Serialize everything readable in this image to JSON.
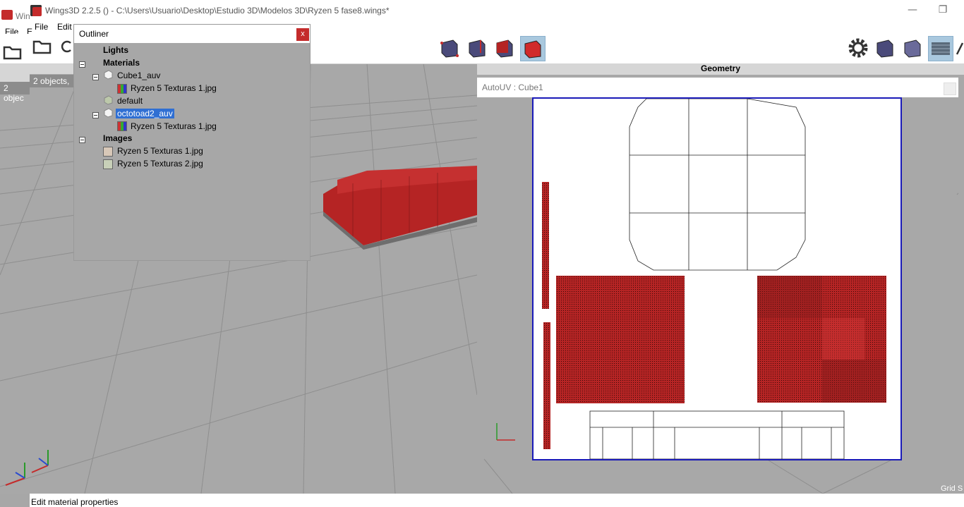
{
  "window": {
    "title": "Wings3D 2.2.5 () - C:\\Users\\Usuario\\Desktop\\Estudio 3D\\Modelos 3D\\Ryzen 5 fase8.wings*",
    "behind_title": "Win",
    "min_glyph": "—",
    "restore_glyph": "❐"
  },
  "menu": {
    "file_back": "File",
    "edit_back": "E",
    "file": "File",
    "edit": "Edit"
  },
  "geometry_info": {
    "back": "2 objec",
    "front": "2 objects, "
  },
  "outliner": {
    "title": "Outliner",
    "close_label": "x",
    "lights": "Lights",
    "materials": "Materials",
    "items": [
      {
        "label": "Cube1_auv"
      },
      {
        "label": "Ryzen 5 Texturas 1.jpg"
      },
      {
        "label": "default"
      },
      {
        "label": "octotoad2_auv"
      },
      {
        "label": "Ryzen 5 Texturas 1.jpg"
      }
    ],
    "images": "Images",
    "image_items": [
      {
        "label": "Ryzen 5 Texturas 1.jpg"
      },
      {
        "label": "Ryzen 5 Texturas 2.jpg"
      }
    ]
  },
  "geometry_header": "Geometry",
  "autouv": {
    "title": "AutoUV : Cube1"
  },
  "grid_label": "Grid S",
  "status": "Edit material properties",
  "colors": {
    "accent_red": "#c42b2b",
    "selection": "#2f6fd3",
    "uv_border": "#1a1ab8",
    "mesh_red": "#b52424"
  }
}
